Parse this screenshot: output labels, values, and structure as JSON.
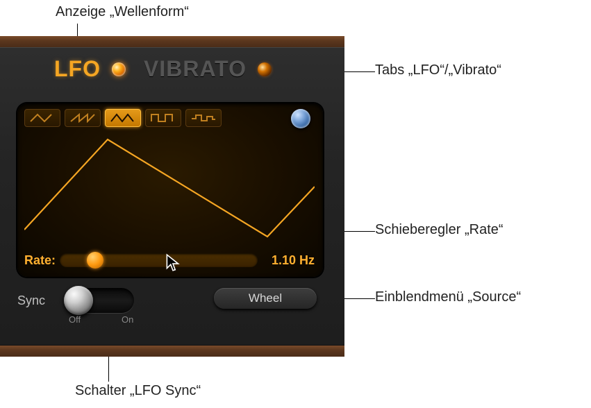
{
  "annotations": {
    "waveform_display": "Anzeige „Wellenform“",
    "tabs": "Tabs „LFO“/„Vibrato“",
    "rate_slider": "Schieberegler „Rate“",
    "source_menu": "Einblendmenü „Source“",
    "sync_switch": "Schalter „LFO Sync“"
  },
  "tabs": {
    "lfo": "LFO",
    "vibrato": "VIBRATO",
    "active": "lfo"
  },
  "waveforms": {
    "options": [
      "triangle-down",
      "saw-up",
      "triangle",
      "square",
      "random"
    ],
    "selected": "triangle"
  },
  "rate": {
    "label": "Rate:",
    "value_text": "1.10 Hz",
    "value_hz": 1.1,
    "slider_position_pct": 18
  },
  "sync": {
    "label": "Sync",
    "off_label": "Off",
    "on_label": "On",
    "state": "off"
  },
  "source_menu": {
    "selected": "Wheel"
  },
  "colors": {
    "accent": "#ffb030",
    "lamp": "#ffb320",
    "panel_bg": "#1a0f00"
  }
}
